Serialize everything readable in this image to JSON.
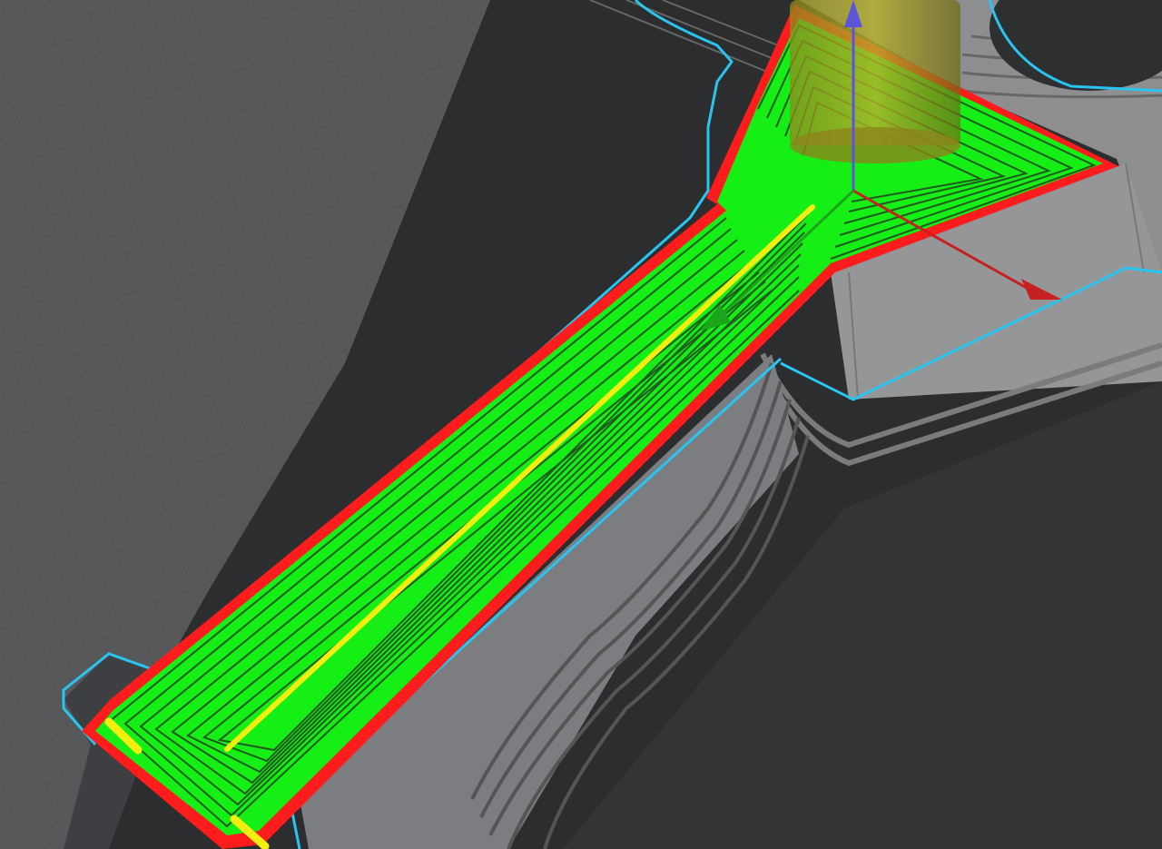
{
  "viewport": {
    "view": "3d-preview",
    "colors": {
      "background": "#2c2d2f",
      "build_plate": "#58595b",
      "plate_grid": "#4b4c4e",
      "model_shadow": "#2a2b2d",
      "model_surface": "#3c3d40",
      "layer_lines": "#8f8f91",
      "skirt": "#29c4f0",
      "outer_wall": "#ff1c1c",
      "inner_wall": "#16ef16",
      "infill": "#f2ee10",
      "nozzle": "#a8a020",
      "axis_x": "#c62020",
      "axis_y": "#1aa51a",
      "axis_z": "#5b56d8"
    },
    "icons": [
      "move-gizmo-icon",
      "nozzle-icon"
    ]
  }
}
